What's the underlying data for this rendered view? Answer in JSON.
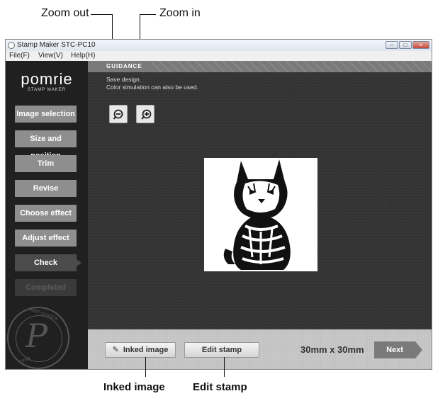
{
  "callouts": {
    "zoom_out": "Zoom out",
    "zoom_in": "Zoom in",
    "inked_image": "Inked image",
    "edit_stamp": "Edit stamp"
  },
  "window": {
    "title": "Stamp Maker STC-PC10",
    "controls": {
      "minimize": "–",
      "maximize": "□",
      "close": "×"
    }
  },
  "menu": [
    "File(F)",
    "View(V)",
    "Help(H)"
  ],
  "sidebar": {
    "logo_name": "pomrie",
    "logo_sub": "STAMP MAKER",
    "steps": [
      {
        "label": "Image selection",
        "state": "normal"
      },
      {
        "label": "Size and position",
        "state": "normal"
      },
      {
        "label": "Trim",
        "state": "normal"
      },
      {
        "label": "Revise",
        "state": "normal"
      },
      {
        "label": "Choose effect",
        "state": "normal"
      },
      {
        "label": "Adjust effect",
        "state": "normal"
      },
      {
        "label": "Check",
        "state": "current"
      },
      {
        "label": "Completed",
        "state": "disabled"
      }
    ],
    "seal_top": "STAMP MAKER",
    "seal_letter": "P",
    "seal_bottom": "Pomrie"
  },
  "guidance": {
    "title": "GUIDANCE",
    "line1": "Save design.",
    "line2": "Color simulation can also be used."
  },
  "toolbar": {
    "zoom_out_icon": "zoom-out-icon",
    "zoom_in_icon": "zoom-in-icon"
  },
  "preview": {
    "image": "kitten stamp preview"
  },
  "bottom": {
    "inked_button": "Inked image",
    "edit_button": "Edit stamp",
    "size": "30mm x 30mm",
    "next_button": "Next"
  },
  "colors": {
    "sidebar_bg": "#202020",
    "step_bg": "#8e8e8e",
    "main_bg": "#333333",
    "next_bg": "#7a7a7a"
  }
}
